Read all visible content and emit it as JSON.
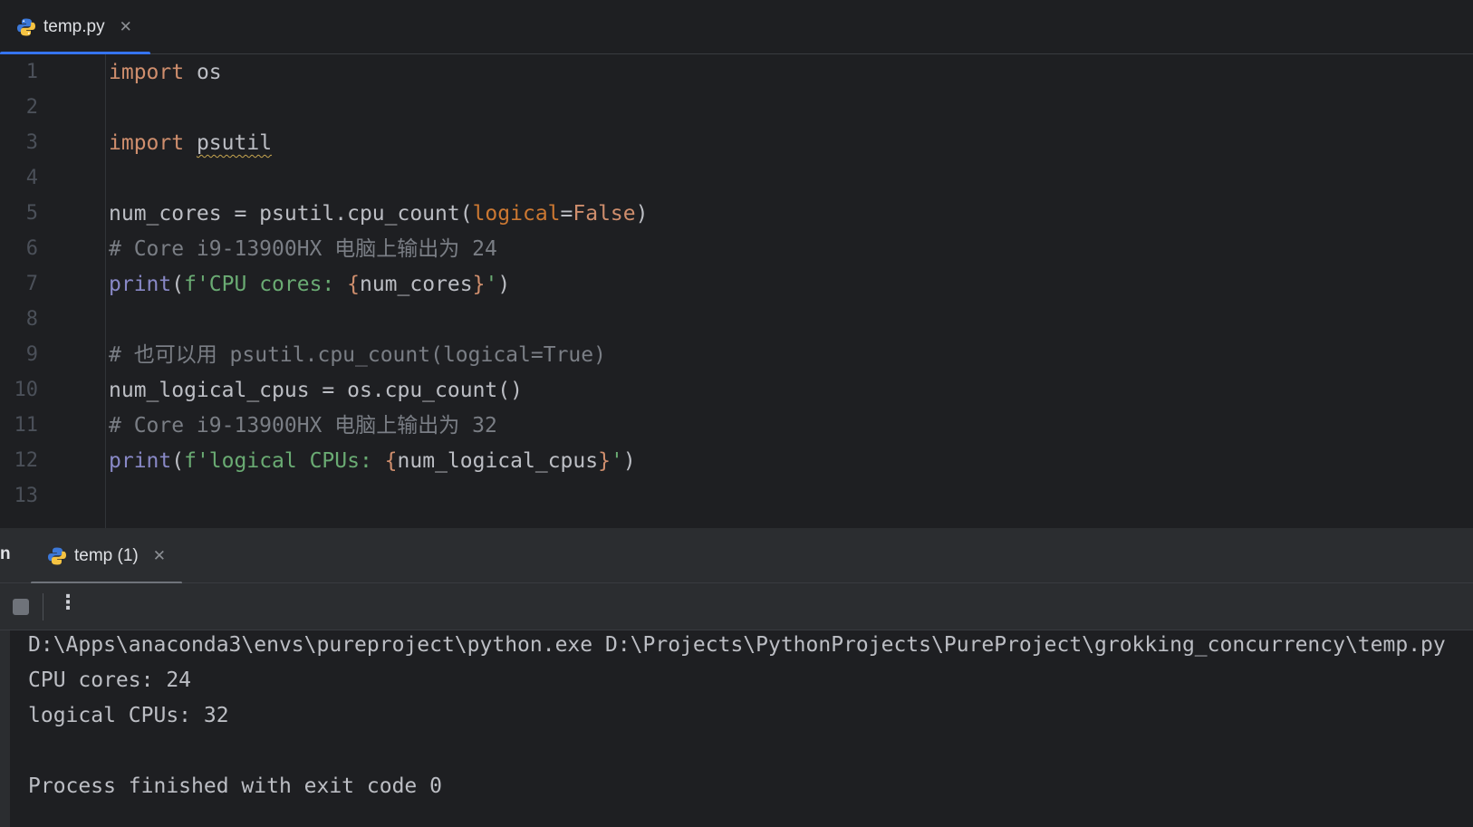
{
  "editor_tab": {
    "file_name": "temp.py",
    "close_glyph": "✕"
  },
  "code_lines": [
    {
      "n": "1",
      "tokens": [
        {
          "t": "import",
          "c": "kw"
        },
        {
          "t": " os",
          "c": "id"
        }
      ]
    },
    {
      "n": "2",
      "tokens": []
    },
    {
      "n": "3",
      "tokens": [
        {
          "t": "import",
          "c": "kw"
        },
        {
          "t": " ",
          "c": "id"
        },
        {
          "t": "psutil",
          "c": "id squiggle"
        }
      ]
    },
    {
      "n": "4",
      "tokens": []
    },
    {
      "n": "5",
      "tokens": [
        {
          "t": "num_cores = psutil.cpu_count(",
          "c": "id"
        },
        {
          "t": "logical",
          "c": "param"
        },
        {
          "t": "=",
          "c": "id"
        },
        {
          "t": "False",
          "c": "const"
        },
        {
          "t": ")",
          "c": "id"
        }
      ]
    },
    {
      "n": "6",
      "tokens": [
        {
          "t": "# Core i9-13900HX 电脑上输出为 24",
          "c": "cm"
        }
      ]
    },
    {
      "n": "7",
      "tokens": [
        {
          "t": "print",
          "c": "fn"
        },
        {
          "t": "(",
          "c": "id"
        },
        {
          "t": "f'CPU cores: ",
          "c": "str"
        },
        {
          "t": "{",
          "c": "brace"
        },
        {
          "t": "num_cores",
          "c": "id"
        },
        {
          "t": "}",
          "c": "brace"
        },
        {
          "t": "'",
          "c": "str"
        },
        {
          "t": ")",
          "c": "id"
        }
      ]
    },
    {
      "n": "8",
      "tokens": []
    },
    {
      "n": "9",
      "tokens": [
        {
          "t": "# 也可以用 psutil.cpu_count(logical=True)",
          "c": "cm"
        }
      ]
    },
    {
      "n": "10",
      "tokens": [
        {
          "t": "num_logical_cpus = os.cpu_count()",
          "c": "id"
        }
      ]
    },
    {
      "n": "11",
      "tokens": [
        {
          "t": "# Core i9-13900HX 电脑上输出为 32",
          "c": "cm"
        }
      ]
    },
    {
      "n": "12",
      "tokens": [
        {
          "t": "print",
          "c": "fn"
        },
        {
          "t": "(",
          "c": "id"
        },
        {
          "t": "f'logical CPUs: ",
          "c": "str"
        },
        {
          "t": "{",
          "c": "brace"
        },
        {
          "t": "num_logical_cpus",
          "c": "id"
        },
        {
          "t": "}",
          "c": "brace"
        },
        {
          "t": "'",
          "c": "str"
        },
        {
          "t": ")",
          "c": "id"
        }
      ]
    },
    {
      "n": "13",
      "tokens": []
    }
  ],
  "run_panel": {
    "side_label": "n",
    "tab_label": "temp (1)",
    "close_glyph": "✕",
    "more_glyph": "⋮"
  },
  "console": {
    "lines": [
      "D:\\Apps\\anaconda3\\envs\\pureproject\\python.exe D:\\Projects\\PythonProjects\\PureProject\\grokking_concurrency\\temp.py",
      "CPU cores: 24",
      "logical CPUs: 32",
      "",
      "Process finished with exit code 0"
    ]
  },
  "colors": {
    "accent": "#3574f0",
    "keyword": "#cf8e6d",
    "string": "#6aab73",
    "comment": "#7a7e85",
    "builtin": "#8888c6"
  },
  "icons": {
    "file_icon": "python-icon",
    "stop_icon": "stop-icon",
    "more_icon": "more-vertical-icon"
  }
}
